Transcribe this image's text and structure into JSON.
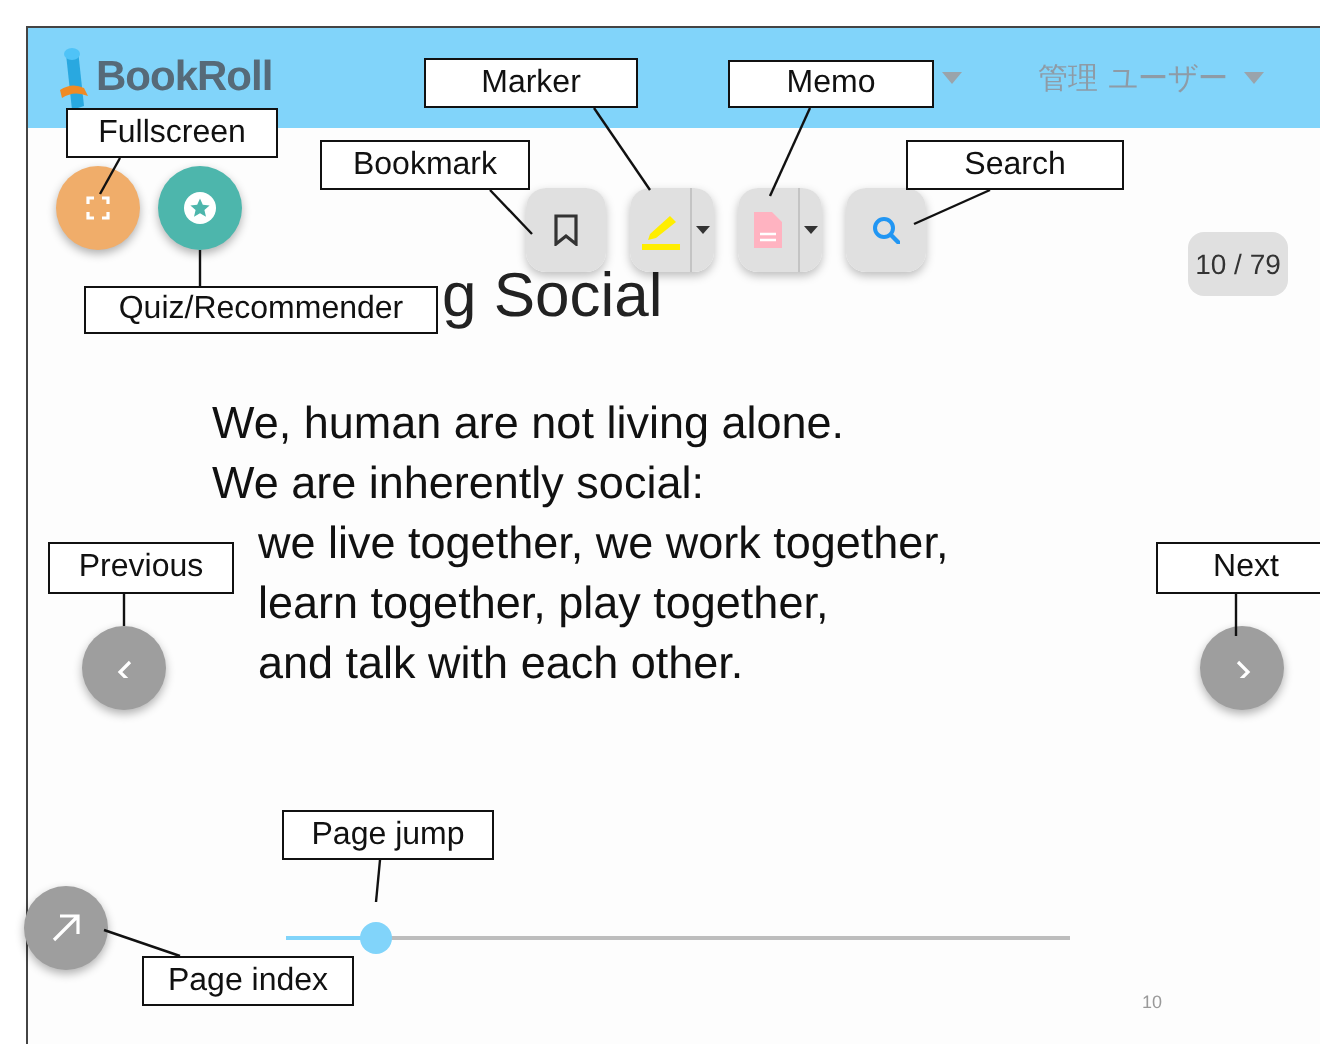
{
  "header": {
    "logo": "BookRoll",
    "user_menu": "管理 ユーザー"
  },
  "floating_buttons": [
    {
      "kind": "fullscreen"
    },
    {
      "kind": "quiz"
    },
    {
      "kind": "previous"
    },
    {
      "kind": "next"
    },
    {
      "kind": "page_index"
    }
  ],
  "toolbar": [
    {
      "kind": "bookmark",
      "dropdown": false
    },
    {
      "kind": "marker",
      "dropdown": true
    },
    {
      "kind": "memo",
      "dropdown": true
    },
    {
      "kind": "search",
      "dropdown": false
    }
  ],
  "page_counter": "10 / 79",
  "slide": {
    "title": "g Social",
    "lines": [
      {
        "text": "We, human are not living alone.",
        "indented": false
      },
      {
        "text": "We are inherently social:",
        "indented": false
      },
      {
        "text": "we live together, we work together,",
        "indented": true
      },
      {
        "text": "learn together, play together,",
        "indented": true
      },
      {
        "text": "and talk with each other.",
        "indented": true
      }
    ],
    "page_number": "10"
  },
  "page_slider": {
    "level": 0.115
  },
  "callouts": [
    {
      "label": "Fullscreen"
    },
    {
      "label": "Marker"
    },
    {
      "label": "Memo"
    },
    {
      "label": "Bookmark"
    },
    {
      "label": "Search"
    },
    {
      "label": "Quiz/Recommender"
    },
    {
      "label": "Previous"
    },
    {
      "label": "Next"
    },
    {
      "label": "Page jump"
    },
    {
      "label": "Page index"
    }
  ]
}
